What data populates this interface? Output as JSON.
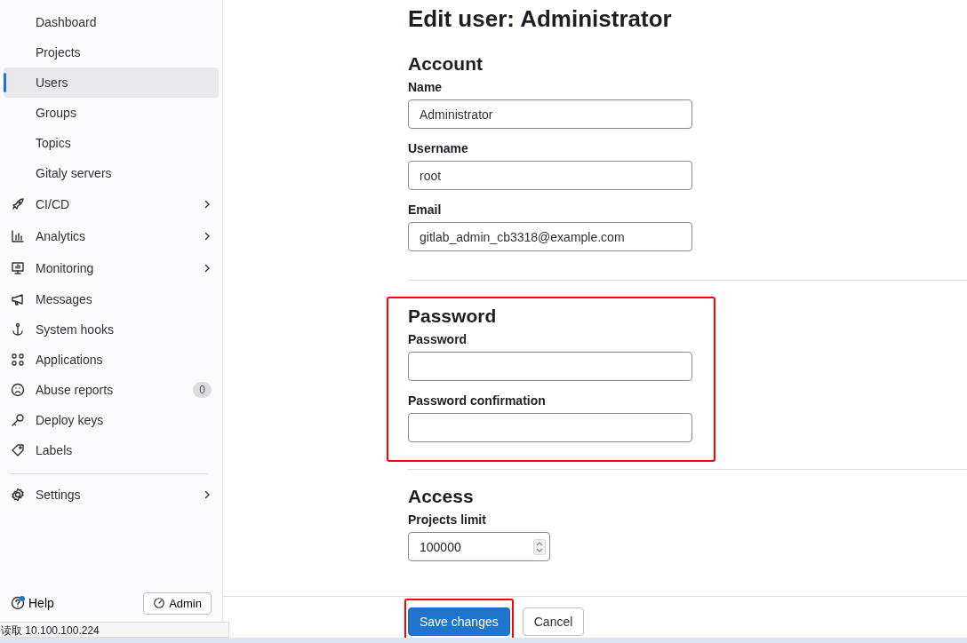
{
  "sidebar": {
    "items": [
      {
        "label": "Dashboard",
        "kind": "sub",
        "selected": false
      },
      {
        "label": "Projects",
        "kind": "sub",
        "selected": false
      },
      {
        "label": "Users",
        "kind": "sub",
        "selected": true
      },
      {
        "label": "Groups",
        "kind": "sub",
        "selected": false
      },
      {
        "label": "Topics",
        "kind": "sub",
        "selected": false
      },
      {
        "label": "Gitaly servers",
        "kind": "sub",
        "selected": false
      },
      {
        "label": "CI/CD",
        "kind": "group",
        "selected": false
      },
      {
        "label": "Analytics",
        "kind": "group",
        "selected": false
      },
      {
        "label": "Monitoring",
        "kind": "group",
        "selected": false
      },
      {
        "label": "Messages",
        "kind": "link",
        "selected": false
      },
      {
        "label": "System hooks",
        "kind": "link",
        "selected": false
      },
      {
        "label": "Applications",
        "kind": "link",
        "selected": false
      },
      {
        "label": "Abuse reports",
        "kind": "link",
        "selected": false,
        "badge": "0"
      },
      {
        "label": "Deploy keys",
        "kind": "link",
        "selected": false
      },
      {
        "label": "Labels",
        "kind": "link",
        "selected": false
      },
      {
        "label": "Settings",
        "kind": "group",
        "selected": false,
        "divider_before": true
      }
    ],
    "footer": {
      "help": "Help",
      "help_notification": true,
      "admin": "Admin"
    }
  },
  "title": "Edit user: Administrator",
  "sections": [
    {
      "heading": "Account",
      "highlighted": false,
      "fields": [
        {
          "label": "Name",
          "kind": "text",
          "value": "Administrator"
        },
        {
          "label": "Username",
          "kind": "text",
          "value": "root"
        },
        {
          "label": "Email",
          "kind": "text",
          "value": "gitlab_admin_cb3318@example.com"
        }
      ]
    },
    {
      "heading": "Password",
      "highlighted": true,
      "fields": [
        {
          "label": "Password",
          "kind": "password"
        },
        {
          "label": "Password confirmation",
          "kind": "password"
        }
      ]
    },
    {
      "heading": "Access",
      "highlighted": false,
      "fields": [
        {
          "label": "Projects limit",
          "kind": "number",
          "value": "100000"
        }
      ]
    }
  ],
  "actions": [
    {
      "label": "Save changes",
      "kind": "primary",
      "highlighted": true
    },
    {
      "label": "Cancel",
      "kind": "secondary",
      "highlighted": false
    }
  ],
  "status_bar": {
    "text": "读取 10.100.100.224"
  }
}
